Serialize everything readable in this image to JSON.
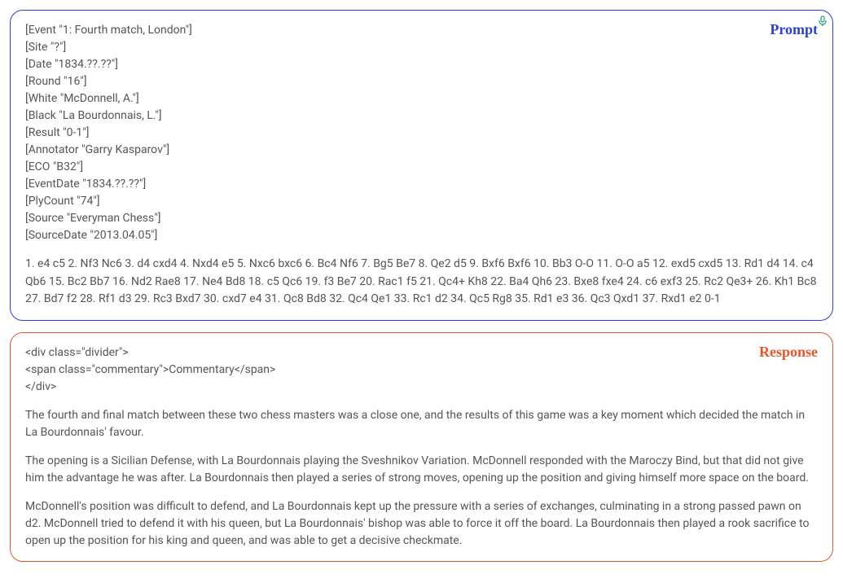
{
  "prompt": {
    "label": "Prompt",
    "mic_icon": "mic-icon",
    "headers": [
      "[Event \"1: Fourth match, London\"]",
      "[Site \"?\"]",
      "[Date \"1834.??.??\"]",
      "[Round \"16\"]",
      "[White \"McDonnell, A.\"]",
      "[Black \"La Bourdonnais, L.\"]",
      "[Result \"0-1\"]",
      "[Annotator \"Garry Kasparov\"]",
      "[ECO \"B32\"]",
      "[EventDate \"1834.??.??\"]",
      "[PlyCount \"74\"]",
      "[Source \"Everyman Chess\"]",
      "[SourceDate \"2013.04.05\"]"
    ],
    "moves": "1. e4 c5 2. Nf3 Nc6 3. d4 cxd4 4. Nxd4 e5 5. Nxc6 bxc6 6. Bc4 Nf6 7. Bg5 Be7 8. Qe2 d5 9. Bxf6 Bxf6 10. Bb3 O-O 11. O-O a5 12. exd5 cxd5 13. Rd1 d4 14. c4 Qb6 15. Bc2 Bb7 16. Nd2 Rae8 17. Ne4 Bd8 18. c5 Qc6 19. f3 Be7 20. Rac1 f5 21. Qc4+ Kh8 22. Ba4 Qh6 23. Bxe8 fxe4 24. c6 exf3 25. Rc2 Qe3+ 26. Kh1 Bc8 27. Bd7 f2 28. Rf1 d3 29. Rc3 Bxd7 30. cxd7 e4 31. Qc8 Bd8 32. Qc4 Qe1 33. Rc1 d2 34. Qc5 Rg8 35. Rd1 e3 36. Qc3 Qxd1 37. Rxd1 e2 0-1"
  },
  "response": {
    "label": "Response",
    "codeblock": {
      "line1": "<div class=\"divider\">",
      "line2": "<span class=\"commentary\">Commentary</span>",
      "line3": "</div>"
    },
    "paragraphs": [
      "The fourth and final match between these two chess masters was a close one, and the results of this game was a key moment which decided the match in La Bourdonnais' favour.",
      "The opening is a Sicilian Defense, with La Bourdonnais playing the Sveshnikov Variation. McDonnell responded with the Maroczy Bind, but that did not give him the advantage he was after. La Bourdonnais then played a series of strong moves, opening up the position and giving himself more space on the board.",
      "McDonnell's position was difficult to defend, and La Bourdonnais kept up the pressure with a series of exchanges, culminating in a strong passed pawn on d2. McDonnell tried to defend it with his queen, but La Bourdonnais' bishop was able to force it off the board. La Bourdonnais then played a rook sacrifice to open up the position for his king and queen, and was able to get a decisive checkmate."
    ]
  }
}
